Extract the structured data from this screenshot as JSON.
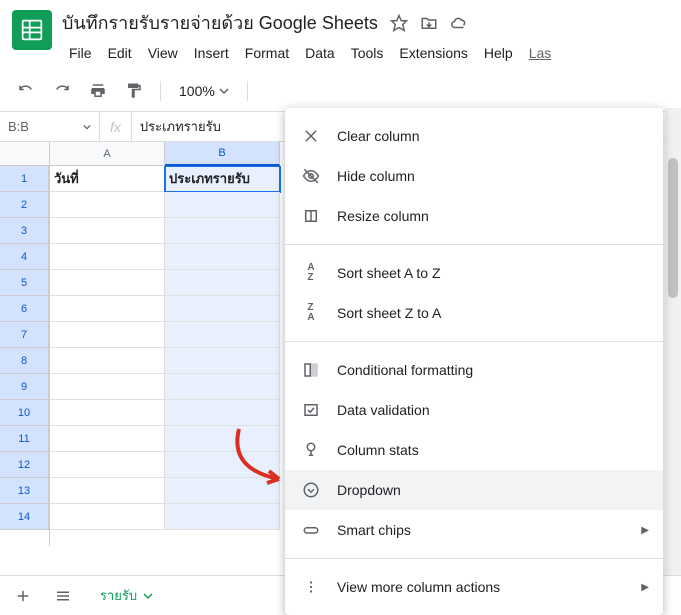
{
  "doc": {
    "title": "บันทึกรายรับรายจ่ายด้วย Google Sheets"
  },
  "menubar": [
    "File",
    "Edit",
    "View",
    "Insert",
    "Format",
    "Data",
    "Tools",
    "Extensions",
    "Help",
    "Las"
  ],
  "toolbar": {
    "zoom": "100%"
  },
  "formula": {
    "name_box": "B:B",
    "fx_value": "ประเภทรายรับ"
  },
  "columns": [
    "A",
    "B"
  ],
  "selected_column": "B",
  "rows": [
    1,
    2,
    3,
    4,
    5,
    6,
    7,
    8,
    9,
    10,
    11,
    12,
    13,
    14
  ],
  "cells": {
    "A1": "วันที่",
    "B1": "ประเภทรายรับ"
  },
  "sheet_tab": "รายรับ",
  "context_menu": {
    "items": [
      {
        "icon": "clear",
        "label": "Clear column"
      },
      {
        "icon": "hide",
        "label": "Hide column"
      },
      {
        "icon": "resize",
        "label": "Resize column"
      }
    ],
    "sort": [
      {
        "icon": "az",
        "label": "Sort sheet A to Z"
      },
      {
        "icon": "za",
        "label": "Sort sheet Z to A"
      }
    ],
    "data": [
      {
        "icon": "cond",
        "label": "Conditional formatting"
      },
      {
        "icon": "valid",
        "label": "Data validation"
      },
      {
        "icon": "stats",
        "label": "Column stats"
      },
      {
        "icon": "dropdown",
        "label": "Dropdown",
        "highlight": true
      },
      {
        "icon": "chips",
        "label": "Smart chips",
        "submenu": true
      }
    ],
    "more": [
      {
        "icon": "more",
        "label": "View more column actions",
        "submenu": true
      }
    ]
  }
}
